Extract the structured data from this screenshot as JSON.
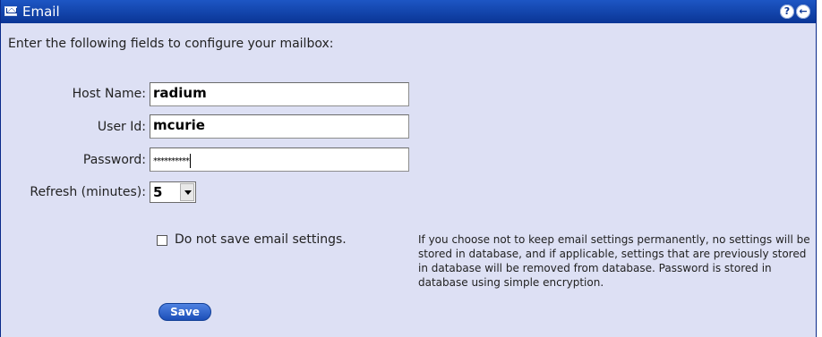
{
  "window": {
    "title": "Email",
    "help_icon": "question-mark",
    "back_icon": "back-arrow",
    "help_glyph": "?",
    "back_glyph": "←"
  },
  "intro_text": "Enter the following fields to configure your mailbox:",
  "fields": {
    "host_name": {
      "label": "Host Name:",
      "value": "radium"
    },
    "user_id": {
      "label": "User Id:",
      "value": "mcurie"
    },
    "password": {
      "label": "Password:",
      "value": "**********"
    },
    "refresh": {
      "label": "Refresh (minutes):",
      "value": "5"
    }
  },
  "checkbox": {
    "label": "Do not save email settings.",
    "checked": false
  },
  "note": "If you choose not to keep email settings permanently, no settings will be stored in database, and if applicable, settings that are previously stored in database will be removed from database. Password is stored in database using simple encryption.",
  "save_label": "Save",
  "colors": {
    "titlebar": "#0b3fa6",
    "panel": "#dde0f4",
    "button": "#2d62cc"
  }
}
